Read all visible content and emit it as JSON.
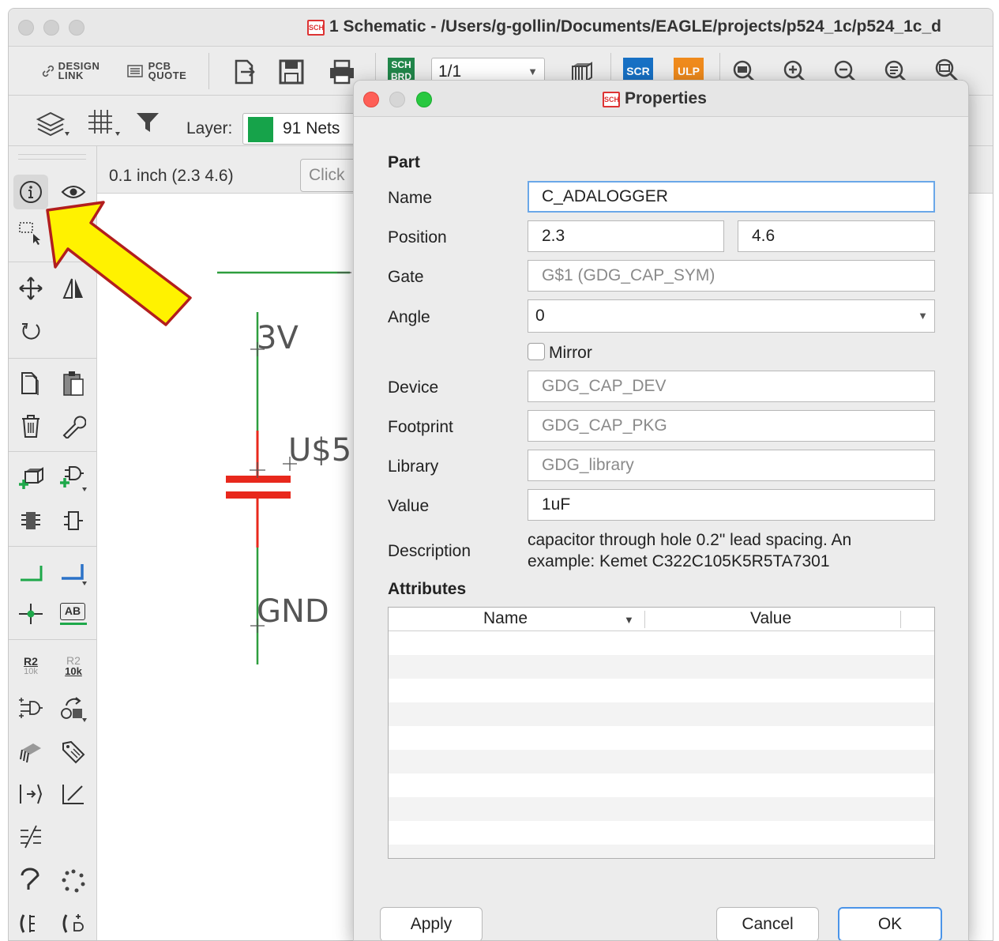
{
  "window": {
    "title": "1 Schematic - /Users/g-gollin/Documents/EAGLE/projects/p524_1c/p524_1c_d",
    "title_badge": "SCH"
  },
  "toolbar": {
    "design_link_line1": "DESIGN",
    "design_link_line2": "LINK",
    "pcb_quote_line1": "PCB",
    "pcb_quote_line2": "QUOTE",
    "sch_brd_line1": "SCH",
    "sch_brd_line2": "BRD",
    "sheet_select": "1/1",
    "scr_label": "SCR",
    "ulp_label": "ULP",
    "layer_label": "Layer:",
    "layer_value": "91 Nets",
    "layer_color": "#16a34a"
  },
  "canvas": {
    "coordinates": "0.1 inch (2.3 4.6)",
    "click_hint": "Click",
    "label_3v": "3V",
    "label_us5": "U$5",
    "label_gnd": "GND",
    "net_color": "#2e9e3e",
    "part_color": "#e8281c"
  },
  "palette": {
    "r2_label": "R2",
    "r2_value": "10k",
    "ab_label": "AB"
  },
  "dialog": {
    "title": "Properties",
    "title_badge": "SCH",
    "section_part": "Part",
    "name_label": "Name",
    "name_value": "C_ADALOGGER",
    "position_label": "Position",
    "position_x": "2.3",
    "position_y": "4.6",
    "gate_label": "Gate",
    "gate_value": "G$1 (GDG_CAP_SYM)",
    "angle_label": "Angle",
    "angle_value": "0",
    "mirror_label": "Mirror",
    "mirror_checked": false,
    "device_label": "Device",
    "device_value": "GDG_CAP_DEV",
    "footprint_label": "Footprint",
    "footprint_value": "GDG_CAP_PKG",
    "library_label": "Library",
    "library_value": "GDG_library",
    "value_label": "Value",
    "value_value": "1uF",
    "description_label": "Description",
    "description_line1": "capacitor through hole 0.2\" lead spacing. An",
    "description_line2": "example: Kemet C322C105K5R5TA7301",
    "section_attributes": "Attributes",
    "attr_col_name": "Name",
    "attr_col_value": "Value",
    "apply_button": "Apply",
    "cancel_button": "Cancel",
    "ok_button": "OK"
  },
  "annotation": {
    "arrow_fill": "#fff200",
    "arrow_stroke": "#b21e1e"
  }
}
